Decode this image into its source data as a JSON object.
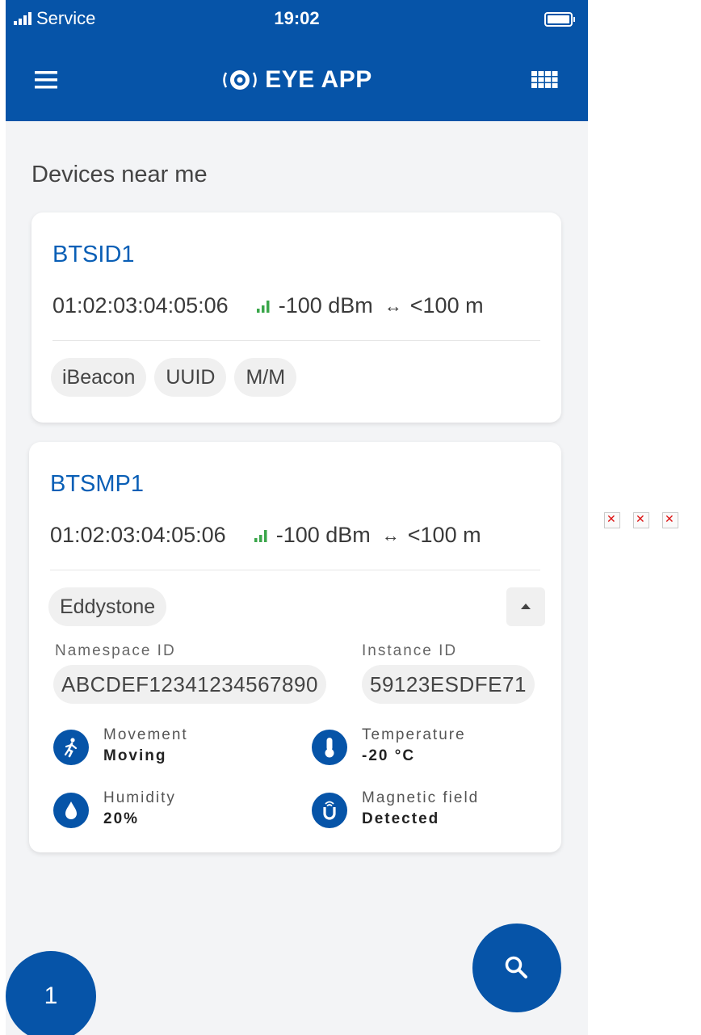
{
  "status_bar": {
    "carrier": "Service",
    "time": "19:02"
  },
  "header": {
    "title": "EYE APP"
  },
  "section_title": "Devices near me",
  "devices": [
    {
      "name": "BTSID1",
      "mac": "01:02:03:04:05:06",
      "rssi": "-100 dBm",
      "distance": "<100 m",
      "tags": [
        "iBeacon",
        "UUID",
        "M/M"
      ]
    },
    {
      "name": "BTSMP1",
      "mac": "01:02:03:04:05:06",
      "rssi": "-100 dBm",
      "distance": "<100 m",
      "tag": "Eddystone",
      "namespace_label": "Namespace ID",
      "namespace_value": "ABCDEF12341234567890",
      "instance_label": "Instance ID",
      "instance_value": "59123ESDFE71",
      "sensors": {
        "movement": {
          "label": "Movement",
          "value": "Moving"
        },
        "temperature": {
          "label": "Temperature",
          "value": "-20 °C"
        },
        "humidity": {
          "label": "Humidity",
          "value": "20%"
        },
        "magnetic": {
          "label": "Magnetic field",
          "value": "Detected"
        }
      }
    }
  ],
  "fab_count": "1",
  "colors": {
    "primary": "#0654a8",
    "link": "#0a5fb6",
    "signal": "#3aa64a",
    "background": "#f3f4f6"
  },
  "icons": [
    "menu-icon",
    "eye-logo-icon",
    "grid-icon",
    "signal-icon",
    "distance-arrow-icon",
    "chevron-up-icon",
    "walking-icon",
    "thermometer-icon",
    "drop-icon",
    "magnet-icon",
    "search-icon",
    "broken-image-icon"
  ]
}
